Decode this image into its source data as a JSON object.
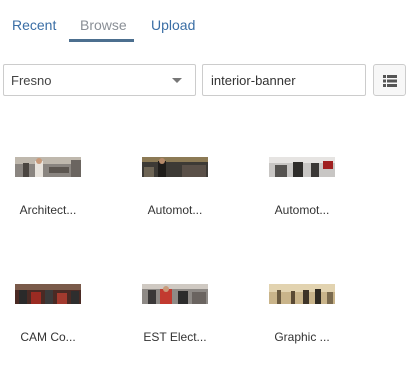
{
  "tabs": [
    {
      "label": "Recent",
      "active": false
    },
    {
      "label": "Browse",
      "active": true
    },
    {
      "label": "Upload",
      "active": false
    }
  ],
  "filter": {
    "location_value": "Fresno",
    "search_value": "interior-banner"
  },
  "icons": {
    "dropdown": "caret-down-icon",
    "view_toggle": "list-view-icon"
  },
  "colors": {
    "link": "#3a6ea5",
    "inactive_tab": "#8a8f96",
    "tab_underline": "#4c6f8f",
    "border": "#cccccc"
  },
  "items": [
    {
      "caption": "Architect..."
    },
    {
      "caption": "Automot..."
    },
    {
      "caption": "Automot..."
    },
    {
      "caption": "CAM Co..."
    },
    {
      "caption": "EST Elect..."
    },
    {
      "caption": "Graphic ..."
    }
  ]
}
